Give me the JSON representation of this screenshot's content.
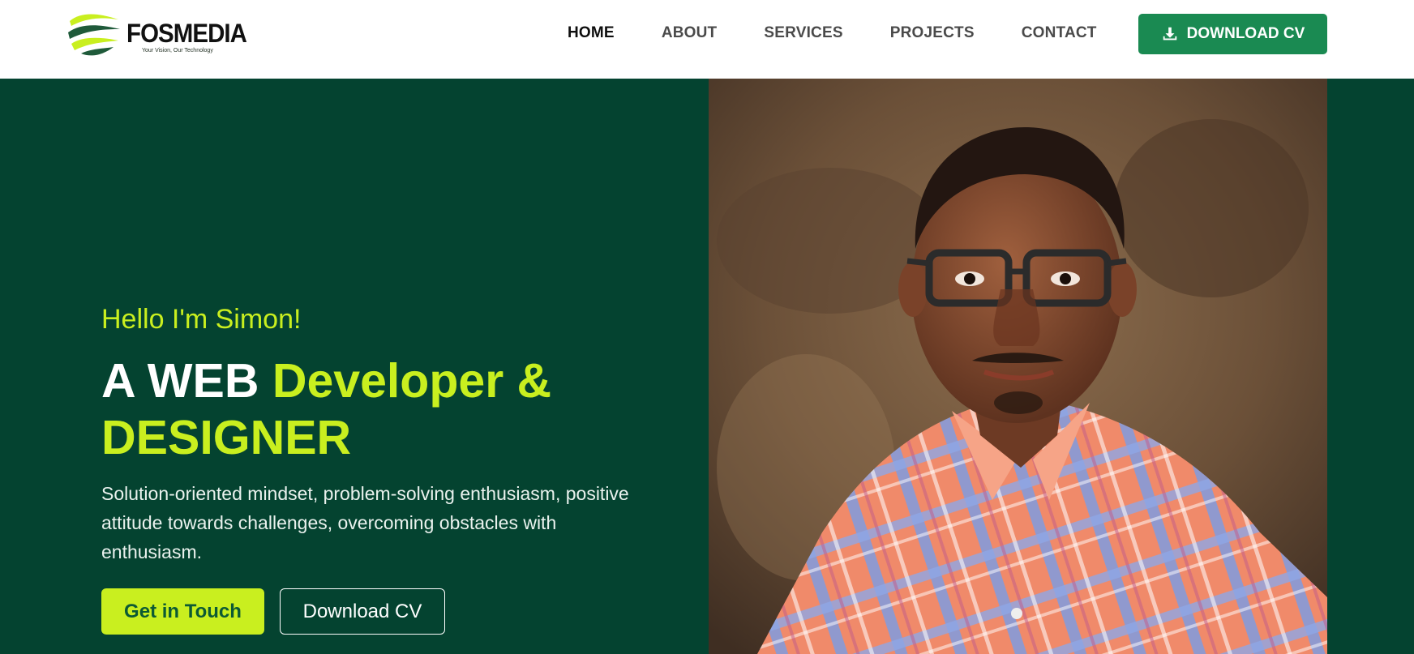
{
  "brand": {
    "name": "FOSMEDIA",
    "tagline": "Your Vision, Our Technology",
    "colors": {
      "primary_green": "#044330",
      "accent_lime": "#c9ef1f",
      "button_green": "#1a8a52"
    }
  },
  "nav": {
    "items": [
      {
        "label": "HOME",
        "active": true
      },
      {
        "label": "ABOUT",
        "active": false
      },
      {
        "label": "SERVICES",
        "active": false
      },
      {
        "label": "PROJECTS",
        "active": false
      },
      {
        "label": "CONTACT",
        "active": false
      }
    ],
    "cta_label": "DOWNLOAD CV",
    "cta_icon": "download-icon"
  },
  "hero": {
    "greeting": "Hello I'm Simon!",
    "headline_white": "A WEB ",
    "headline_accent_1": "Developer &",
    "headline_accent_2": "DESIGNER",
    "description": "Solution-oriented mindset, problem-solving enthusiasm, positive attitude towards challenges, overcoming obstacles with enthusiasm.",
    "primary_button": "Get in Touch",
    "secondary_button": "Download CV",
    "photo": "portrait-photo"
  }
}
